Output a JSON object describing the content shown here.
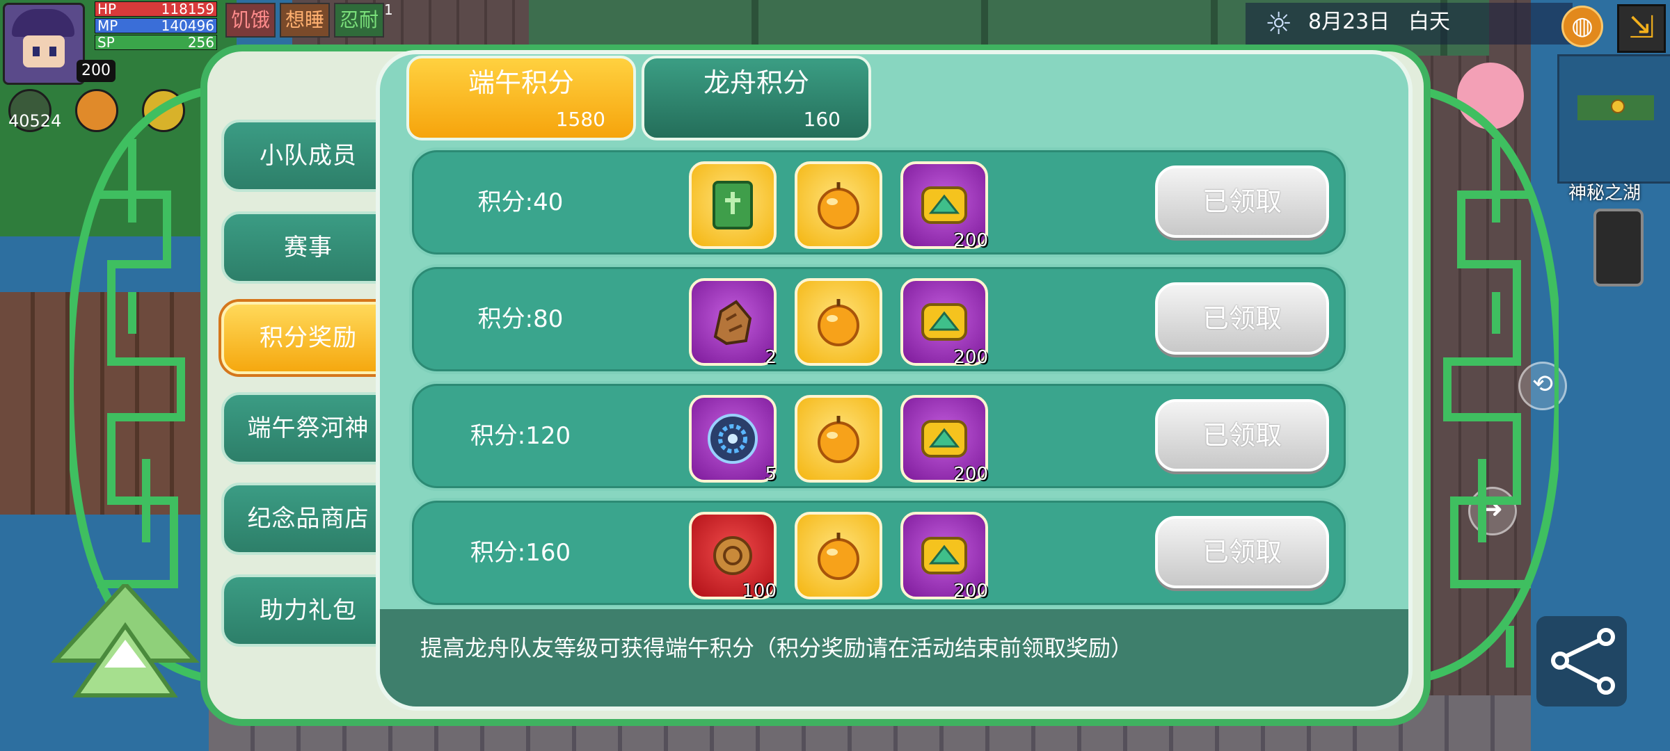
{
  "hud": {
    "stats": [
      {
        "label": "HP",
        "value": "118159",
        "color": "#d83a3a"
      },
      {
        "label": "MP",
        "value": "140496",
        "color": "#3a6ed8"
      },
      {
        "label": "SP",
        "value": "256",
        "color": "#3aa64a"
      }
    ],
    "level": "200",
    "coins": "40524",
    "status_tags": [
      {
        "label": "饥饿",
        "color": "#ff8c8c"
      },
      {
        "label": "想睡",
        "color": "#ffb070"
      },
      {
        "label": "忍耐",
        "color": "#7be07b",
        "badge": "1"
      }
    ],
    "date": "8月23日",
    "time_of_day": "白天",
    "location": "神秘之湖"
  },
  "side_tabs": [
    {
      "label": "小队成员",
      "active": false
    },
    {
      "label": "赛事",
      "active": false
    },
    {
      "label": "积分奖励",
      "active": true
    },
    {
      "label": "端午祭河神",
      "active": false
    },
    {
      "label": "纪念品商店",
      "active": false
    },
    {
      "label": "助力礼包",
      "active": false
    }
  ],
  "top_tabs": [
    {
      "name": "端午积分",
      "points": "1580",
      "active": true
    },
    {
      "name": "龙舟积分",
      "points": "160",
      "active": false
    }
  ],
  "rewards": [
    {
      "label": "积分:40",
      "items": [
        {
          "icon": "green-book-icon",
          "bg": "gold",
          "count": ""
        },
        {
          "icon": "golden-apple-icon",
          "bg": "gold",
          "count": ""
        },
        {
          "icon": "jade-token-icon",
          "bg": "purple",
          "count": "200"
        }
      ],
      "button": "已领取"
    },
    {
      "label": "积分:80",
      "items": [
        {
          "icon": "ore-rock-icon",
          "bg": "purple",
          "count": "2"
        },
        {
          "icon": "golden-apple-icon",
          "bg": "gold",
          "count": ""
        },
        {
          "icon": "jade-token-icon",
          "bg": "purple",
          "count": "200"
        }
      ],
      "button": "已领取"
    },
    {
      "label": "积分:120",
      "items": [
        {
          "icon": "gear-disc-icon",
          "bg": "purple",
          "count": "5"
        },
        {
          "icon": "golden-apple-icon",
          "bg": "gold",
          "count": ""
        },
        {
          "icon": "jade-token-icon",
          "bg": "purple",
          "count": "200"
        }
      ],
      "button": "已领取"
    },
    {
      "label": "积分:160",
      "items": [
        {
          "icon": "bronze-coin-icon",
          "bg": "red",
          "count": "100"
        },
        {
          "icon": "golden-apple-icon",
          "bg": "gold",
          "count": ""
        },
        {
          "icon": "jade-token-icon",
          "bg": "purple",
          "count": "200"
        }
      ],
      "button": "已领取"
    }
  ],
  "footer_text": "提高龙舟队友等级可获得端午积分（积分奖励请在活动结束前领取奖励）",
  "colors": {
    "accent": "#f6a40c",
    "panel": "#88d6c0",
    "row": "#3aa58d",
    "frame": "#3fb260"
  }
}
